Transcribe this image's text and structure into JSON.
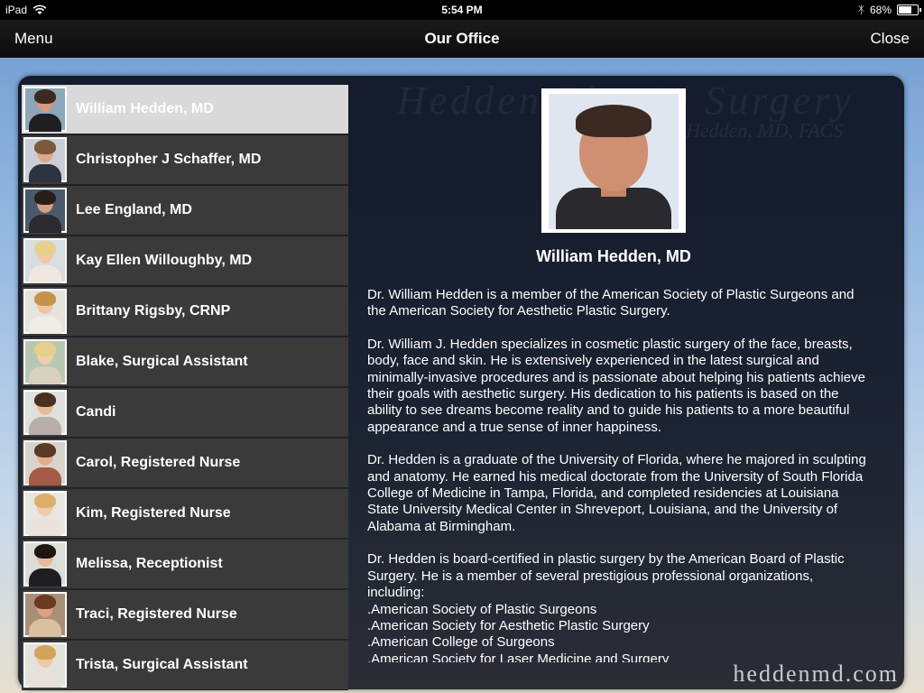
{
  "status": {
    "device": "iPad",
    "time": "5:54 PM",
    "battery": "68%",
    "battery_level": 0.68
  },
  "nav": {
    "menu": "Menu",
    "title": "Our Office",
    "close": "Close"
  },
  "watermark": {
    "top": "Hedden Plastic Surgery",
    "sub": "Hedden, MD, FACS",
    "bottom": "heddenmd.com"
  },
  "staff": [
    {
      "name": "William Hedden, MD",
      "selected": true
    },
    {
      "name": "Christopher J Schaffer, MD"
    },
    {
      "name": "Lee England, MD"
    },
    {
      "name": "Kay Ellen Willoughby, MD"
    },
    {
      "name": "Brittany Rigsby, CRNP"
    },
    {
      "name": "Blake, Surgical Assistant"
    },
    {
      "name": "Candi"
    },
    {
      "name": "Carol, Registered Nurse"
    },
    {
      "name": "Kim, Registered Nurse"
    },
    {
      "name": "Melissa, Receptionist"
    },
    {
      "name": "Traci, Registered Nurse"
    },
    {
      "name": "Trista, Surgical Assistant"
    }
  ],
  "detail": {
    "name": "William Hedden, MD",
    "paragraphs": [
      "Dr. William Hedden is a member of the American Society of Plastic Surgeons and the American Society for Aesthetic Plastic Surgery.",
      "Dr. William J. Hedden specializes in cosmetic plastic surgery of the face, breasts, body, face and skin. He is extensively experienced in the latest surgical and minimally-invasive procedures and is passionate about helping his patients achieve their goals with aesthetic surgery. His dedication to his patients is based on the ability to see dreams become reality and to guide his patients to a more beautiful appearance and a true sense of inner happiness.",
      "Dr. Hedden is a graduate of the University of Florida, where he majored in sculpting and anatomy. He earned his medical doctorate from the University of South Florida College of Medicine in Tampa, Florida, and completed residencies at Louisiana State University Medical Center in Shreveport, Louisiana, and the University of Alabama at Birmingham.",
      "Dr. Hedden is board-certified in plastic surgery by the American Board of Plastic Surgery. He is a member of several prestigious professional organizations, including:"
    ],
    "memberships": [
      ".American Society of Plastic Surgeons",
      ".American Society for Aesthetic Plastic Surgery",
      ".American College of Surgeons",
      ".American Society for Laser Medicine and Surgery"
    ]
  },
  "colors": {
    "row": "#3a3a3a",
    "row_selected": "#d9d9d9",
    "panel": "#121a2a"
  }
}
